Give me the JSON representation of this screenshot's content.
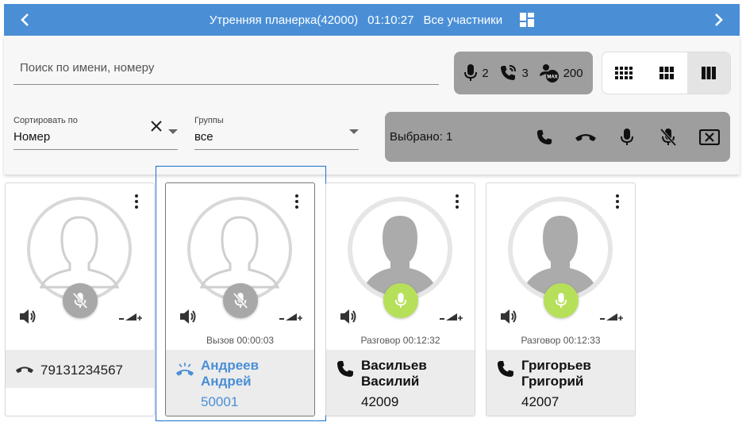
{
  "topbar": {
    "conference_title": "Утренняя планерка(42000)",
    "timer": "01:10:27",
    "participants_label": "Все участники",
    "prev_icon": "chevron-left-icon",
    "next_icon": "chevron-right-icon",
    "dashboard_icon": "dashboard-icon",
    "color": "#4a8fd6"
  },
  "search": {
    "placeholder": "Поиск по имени, номеру",
    "value": ""
  },
  "stats": {
    "mic_count": "2",
    "calls_count": "3",
    "max_count": "200",
    "max_badge": "MAX"
  },
  "layout": {
    "options": [
      "small-grid",
      "medium-grid",
      "large-grid"
    ],
    "active": "large-grid"
  },
  "sort": {
    "label": "Сортировать по",
    "value": "Номер"
  },
  "groups": {
    "label": "Группы",
    "value": "все"
  },
  "selection": {
    "text": "Выбрано: 1",
    "actions": [
      "phone-icon",
      "hangup-icon",
      "mic-icon",
      "mic-off-icon",
      "remove-icon"
    ]
  },
  "cards": [
    {
      "status": "",
      "mic_state": "muted",
      "call_icon": "hangup-icon",
      "name": "",
      "number": "79131234567",
      "avatar_style": "outline"
    },
    {
      "status": "Вызов 00:00:03",
      "mic_state": "muted",
      "call_icon": "ringing-icon",
      "name": "Андреев Андрей",
      "number": "50001",
      "avatar_style": "outline",
      "selected": true
    },
    {
      "status": "Разговор 00:12:32",
      "mic_state": "active",
      "call_icon": "phone-icon",
      "name": "Васильев Василий",
      "number": "42009",
      "avatar_style": "filled"
    },
    {
      "status": "Разговор 00:12:33",
      "mic_state": "active",
      "call_icon": "phone-icon",
      "name": "Григорьев Григорий",
      "number": "42007",
      "avatar_style": "filled"
    }
  ],
  "colors": {
    "accent": "#4a8fd6",
    "mic_active": "#b6e05a",
    "mic_muted": "#a8a8a8",
    "selection_border": "#1a6fd6",
    "panel_gray": "#9e9e9e"
  }
}
